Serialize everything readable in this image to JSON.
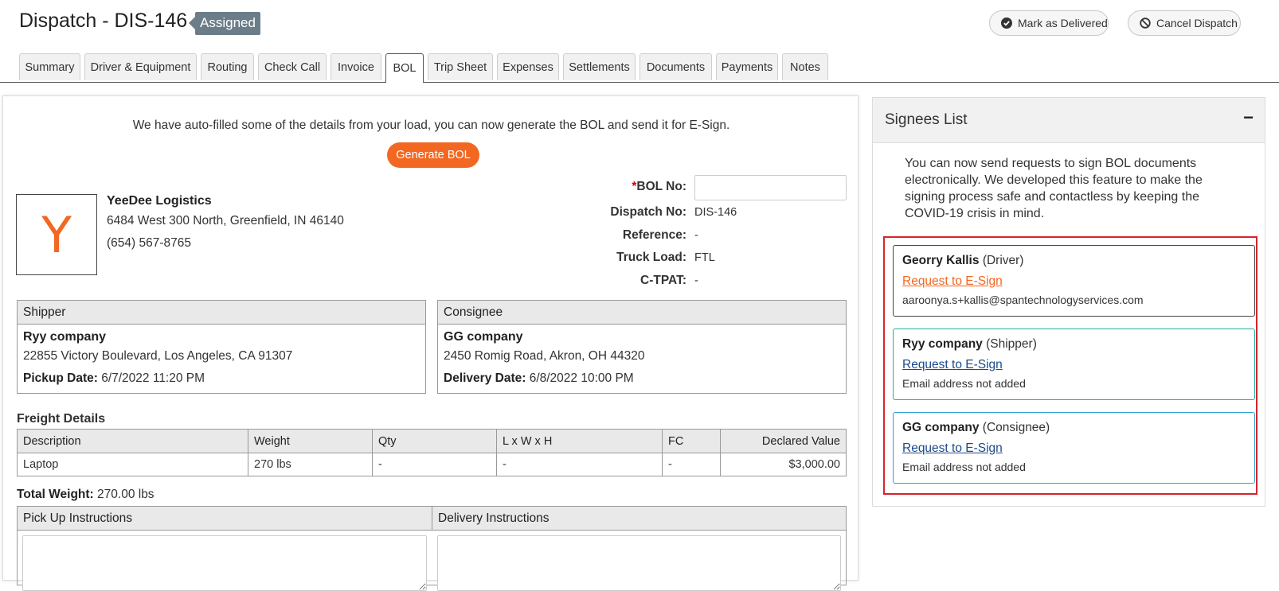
{
  "header": {
    "title": "Dispatch - DIS-146",
    "status": "Assigned",
    "mark_delivered_label": "Mark as Delivered",
    "cancel_dispatch_label": "Cancel Dispatch"
  },
  "tabs": [
    {
      "label": "Summary"
    },
    {
      "label": "Driver & Equipment"
    },
    {
      "label": "Routing"
    },
    {
      "label": "Check Call"
    },
    {
      "label": "Invoice"
    },
    {
      "label": "BOL",
      "active": true
    },
    {
      "label": "Trip Sheet"
    },
    {
      "label": "Expenses"
    },
    {
      "label": "Settlements"
    },
    {
      "label": "Documents"
    },
    {
      "label": "Payments"
    },
    {
      "label": "Notes"
    }
  ],
  "bol": {
    "intro_text": "We have auto-filled some of the details from your load, you can now generate the BOL and send it for E-Sign.",
    "generate_label": "Generate BOL",
    "company": {
      "logo_letter": "Y",
      "name": "YeeDee Logistics",
      "address": "6484 West 300 North, Greenfield, IN 46140",
      "phone": "(654) 567-8765"
    },
    "info": {
      "bol_no_label": "BOL No:",
      "bol_no_value": "",
      "dispatch_no_label": "Dispatch No:",
      "dispatch_no_value": "DIS-146",
      "reference_label": "Reference:",
      "reference_value": "-",
      "truck_load_label": "Truck Load:",
      "truck_load_value": "FTL",
      "ctpat_label": "C-TPAT:",
      "ctpat_value": "-"
    },
    "shipper": {
      "heading": "Shipper",
      "name": "Ryy company",
      "address": "22855 Victory Boulevard, Los Angeles, CA 91307",
      "date_label": "Pickup Date:",
      "date_value": "6/7/2022 11:20 PM"
    },
    "consignee": {
      "heading": "Consignee",
      "name": "GG company",
      "address": "2450 Romig Road, Akron, OH 44320",
      "date_label": "Delivery Date:",
      "date_value": "6/8/2022 10:00 PM"
    },
    "freight": {
      "title": "Freight Details",
      "columns": [
        "Description",
        "Weight",
        "Qty",
        "L x W x H",
        "FC",
        "Declared Value"
      ],
      "rows": [
        [
          "Laptop",
          "270 lbs",
          "-",
          "-",
          "-",
          "$3,000.00"
        ]
      ]
    },
    "total_weight_label": "Total Weight:",
    "total_weight_value": "270.00 lbs",
    "pickup_instructions_label": "Pick Up Instructions",
    "delivery_instructions_label": "Delivery Instructions"
  },
  "signees": {
    "title": "Signees List",
    "collapse_symbol": "−",
    "description": "You can now send requests to sign BOL documents electronically. We developed this feature to make the signing process safe and contactless by keeping the COVID-19 crisis in mind.",
    "items": [
      {
        "name": "Georry Kallis",
        "role": "(Driver)",
        "action": "Request to E-Sign",
        "email": "aaroonya.s+kallis@spantechnologyservices.com"
      },
      {
        "name": "Ryy company",
        "role": "(Shipper)",
        "action": "Request to E-Sign",
        "email": "Email address not added"
      },
      {
        "name": "GG company",
        "role": "(Consignee)",
        "action": "Request to E-Sign",
        "email": "Email address not added"
      }
    ]
  },
  "colors": {
    "accent_orange": "#f26722",
    "badge_gray": "#6c7d8a",
    "link_blue": "#1a4a8a",
    "highlight_red": "#d6252c",
    "card_border_driver": "#444444",
    "card_border_shipper": "#1ab3a6",
    "card_border_consignee": "#2a9fd6"
  }
}
